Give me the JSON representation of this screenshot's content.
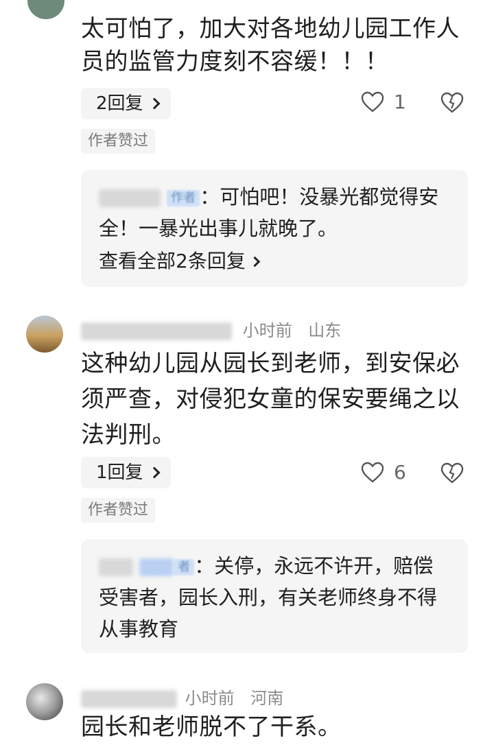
{
  "comments": [
    {
      "text": "太可怕了，加大对各地幼儿园工作人员的监管力度刻不容缓！！！",
      "reply_count_label": "2回复",
      "like_count": "1",
      "author_liked": "作者赞过",
      "reply": {
        "author_tag": "作者",
        "text": "：可怕吧！没暴光都觉得安全！一暴光出事儿就晚了。",
        "view_all": "查看全部2条回复"
      }
    },
    {
      "time": "小时前",
      "location": "山东",
      "text": "这种幼儿园从园长到老师，到安保必须严查，对侵犯女童的保安要绳之以法判刑。",
      "reply_count_label": "1回复",
      "like_count": "6",
      "author_liked": "作者赞过",
      "reply": {
        "author_tag": "者",
        "text": "：关停，永远不许开，赔偿受害者，园长入刑，有关老师终身不得从事教育"
      }
    },
    {
      "time": "小时前",
      "location": "河南",
      "text": "园长和老师脱不了干系。"
    }
  ],
  "colors": {
    "reply_bg": "#f5f5f5",
    "meta_text": "#8a8a8a",
    "author_tag_bg": "#cfe0f7"
  },
  "icons": [
    "heart-outline-icon",
    "broken-heart-icon",
    "chevron-right-icon"
  ]
}
